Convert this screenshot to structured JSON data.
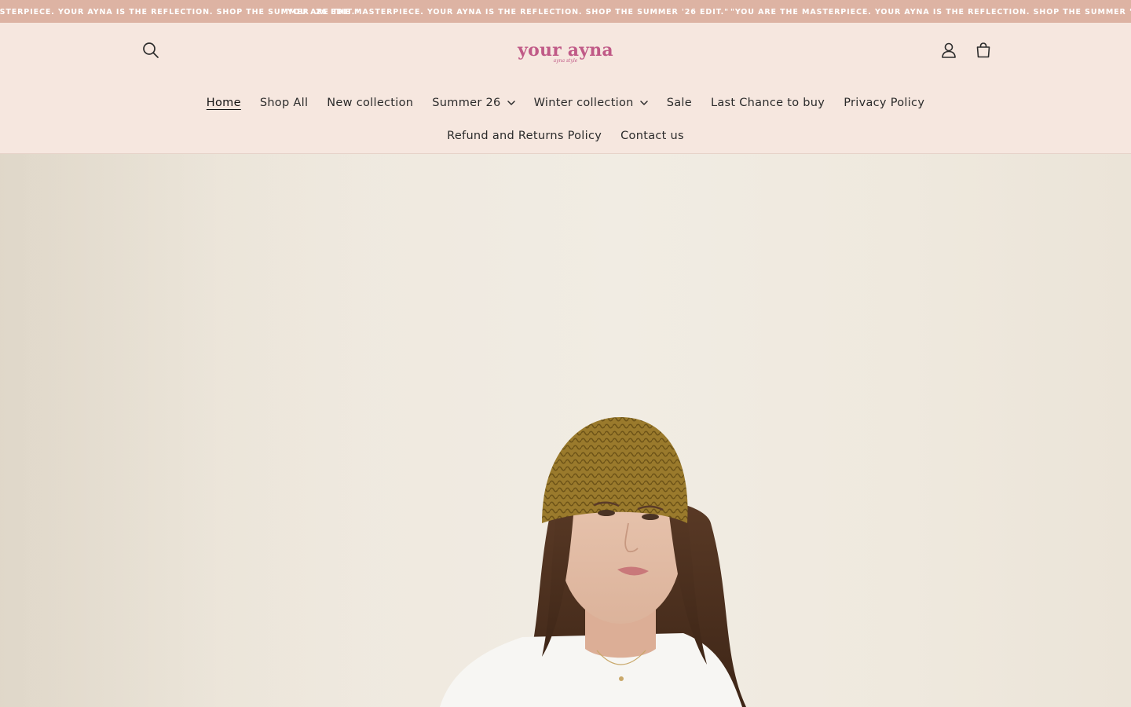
{
  "announcement": {
    "messages": [
      "\"YOU ARE THE MASTERPIECE. YOUR AYNA IS THE REFLECTION. SHOP THE SUMMER '26 EDIT.\"",
      "\"YOU ARE THE MASTERPIECE. YOUR AYNA IS THE REFLECTION. SHOP THE SUMMER '26 EDIT.\"",
      "\"YOU ARE THE MASTERPIECE. YOUR AYNA IS THE REFLECTION. SHOP THE SUMMER '26 EDIT.\""
    ]
  },
  "header": {
    "logo_text": "your ayna",
    "logo_subtext": "ayna style",
    "icons": {
      "search": "search-icon",
      "account": "user-icon",
      "cart": "shopping-bag-icon"
    }
  },
  "nav": {
    "row1": [
      {
        "label": "Home",
        "active": true
      },
      {
        "label": "Shop All"
      },
      {
        "label": "New collection"
      },
      {
        "label": "Summer 26",
        "dropdown": true
      },
      {
        "label": "Winter collection",
        "dropdown": true
      },
      {
        "label": "Sale"
      },
      {
        "label": "Last Chance to buy"
      },
      {
        "label": "Privacy Policy"
      }
    ],
    "row2": [
      {
        "label": "Refund and Returns Policy"
      },
      {
        "label": "Contact us"
      }
    ]
  },
  "colors": {
    "announcement_bg": "#ddb3a3",
    "header_bg": "#f6e7df",
    "logo": "#c05a87",
    "text": "#2b2b2b"
  }
}
